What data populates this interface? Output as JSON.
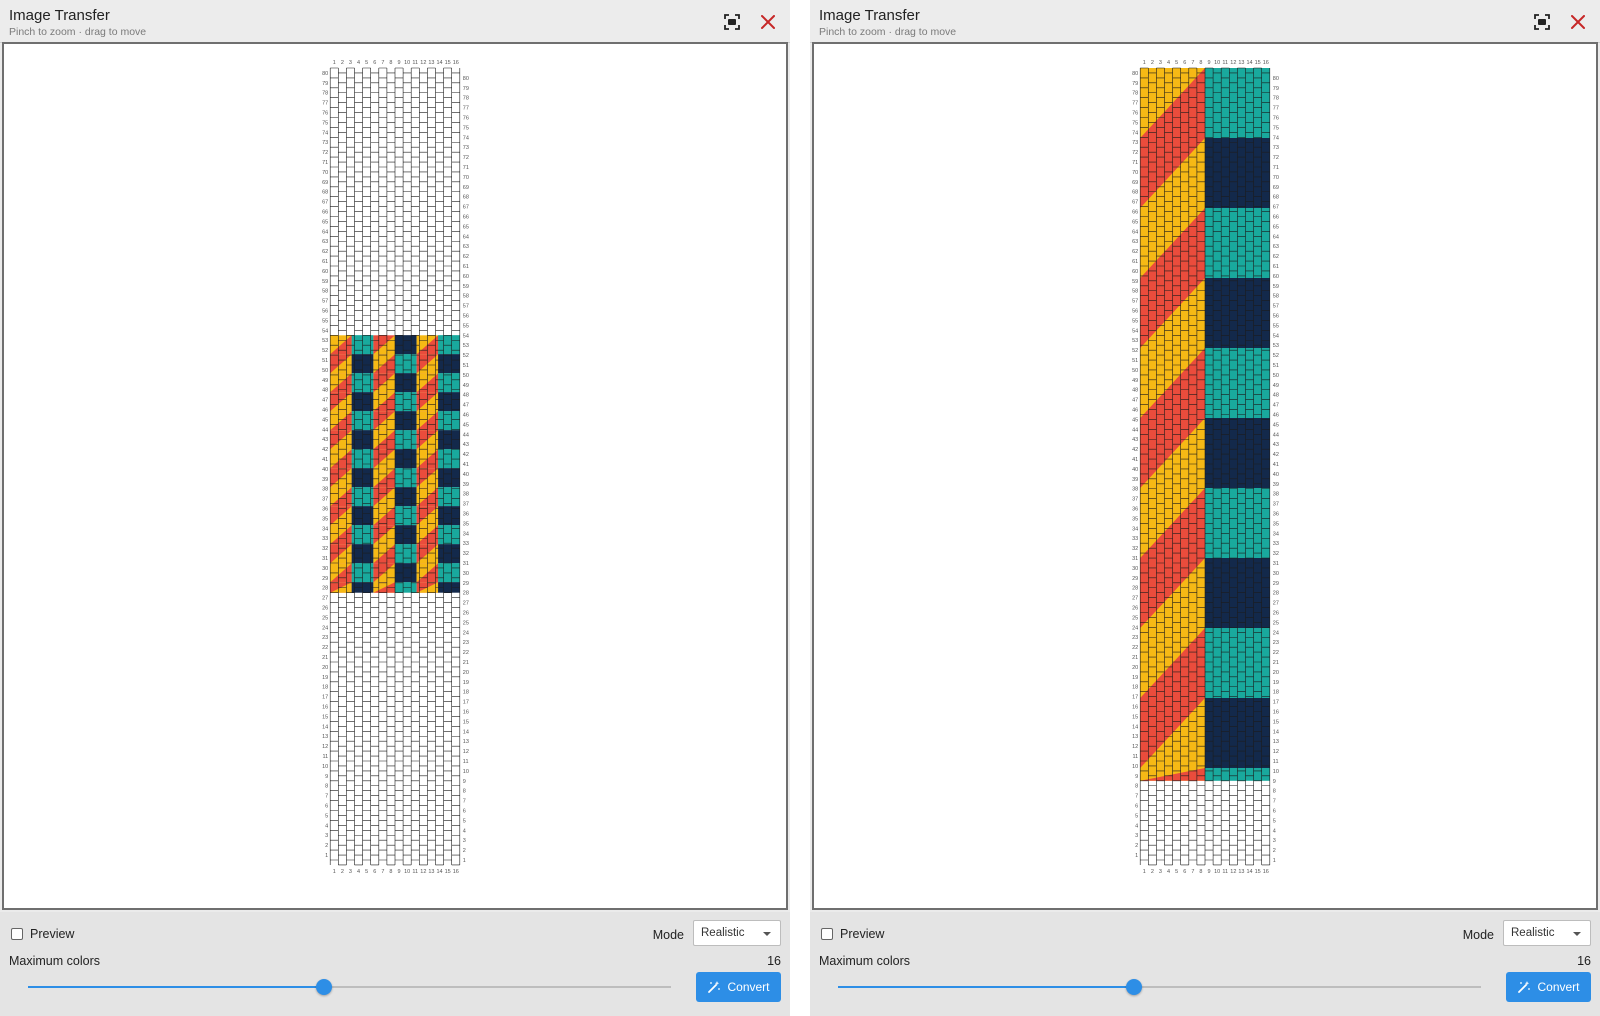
{
  "colors": {
    "navy": "#13294b",
    "red": "#ea4c3c",
    "teal": "#19a99d",
    "yellow": "#f6b915",
    "accent": "#2d8ee6",
    "close": "#c62828"
  },
  "icons": {
    "fit": "fit-screen-icon",
    "close": "close-icon",
    "convert": "magic-wand-icon",
    "dropdown": "chevron-down-icon"
  },
  "panels": [
    {
      "title": "Image Transfer",
      "subtitle": "Pinch to zoom · drag to move",
      "grid": {
        "columns": 16,
        "rows": 80,
        "pattern_start_row": 28,
        "pattern_end_row": 53,
        "pattern_scale": "small"
      },
      "preview": {
        "label": "Preview",
        "checked": false
      },
      "mode": {
        "label": "Mode",
        "value": "Realistic"
      },
      "max_colors": {
        "label": "Maximum colors",
        "value": "16",
        "slider_fraction": 0.46
      },
      "convert_label": "Convert"
    },
    {
      "title": "Image Transfer",
      "subtitle": "Pinch to zoom · drag to move",
      "grid": {
        "columns": 16,
        "rows": 80,
        "pattern_start_row": 9,
        "pattern_end_row": 80,
        "pattern_scale": "large"
      },
      "preview": {
        "label": "Preview",
        "checked": false
      },
      "mode": {
        "label": "Mode",
        "value": "Realistic"
      },
      "max_colors": {
        "label": "Maximum colors",
        "value": "16",
        "slider_fraction": 0.46
      },
      "convert_label": "Convert"
    }
  ]
}
